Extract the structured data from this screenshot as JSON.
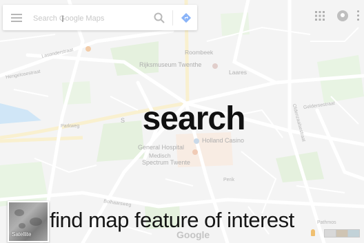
{
  "search": {
    "placeholder": "Search Google Maps",
    "value": ""
  },
  "map": {
    "labels": {
      "roombeek": "Roombeek",
      "rijksmuseum": "Rijksmuseum Twenthe",
      "laares": "Laares",
      "general_hospital": "General Hospital",
      "medisch": "Medisch",
      "spectrum": "Spectrum Twente",
      "holland_casino": "Holland Casino",
      "pathmos": "Pathmos",
      "perik": "Perik",
      "gelderse": "Geldersestraat",
      "lasonder": "Lasonderstraat",
      "oldenzaal": "Oldenzaalsestraat",
      "parkweg": "Parkweg",
      "hengelosestraat": "Hengelosestraat",
      "bolhaarsweg": "Bolhaarsweg",
      "s_partial": "S"
    },
    "colors": {
      "land": "#ececec",
      "road": "#ffffff",
      "park": "#cfe6c4",
      "water": "#a9d2f0",
      "arterial": "#f5e3a8",
      "poi": "#e0a87a"
    },
    "logo": "Google",
    "satellite_label": "Satellite"
  },
  "overlay": {
    "headline": "search",
    "caption": "find map feature of interest"
  }
}
